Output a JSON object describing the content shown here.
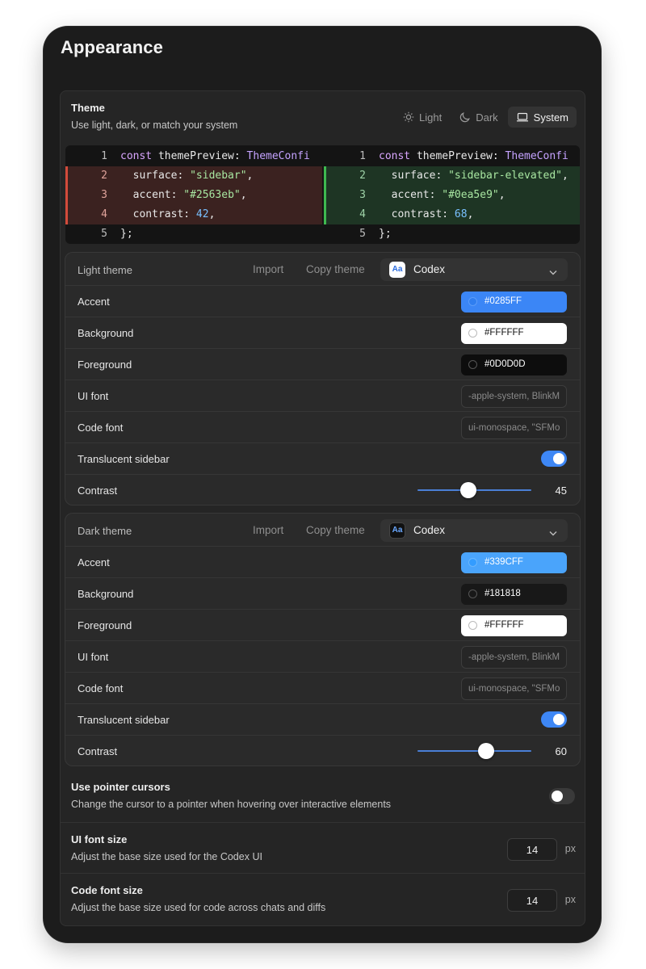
{
  "page": {
    "title": "Appearance"
  },
  "theme": {
    "title": "Theme",
    "subtitle": "Use light, dark, or match your system",
    "modes": [
      {
        "label": "Light",
        "icon": "sun-icon",
        "active": false
      },
      {
        "label": "Dark",
        "icon": "moon-icon",
        "active": false
      },
      {
        "label": "System",
        "icon": "laptop-icon",
        "active": true
      }
    ]
  },
  "diff": {
    "left": [
      {
        "n": "1",
        "parts": [
          [
            "kw",
            "const "
          ],
          [
            "prop",
            "themePreview"
          ],
          [
            "prop",
            ": "
          ],
          [
            "ty",
            "ThemeConfi"
          ]
        ],
        "changed": false
      },
      {
        "n": "2",
        "parts": [
          [
            "prop",
            "  surface: "
          ],
          [
            "str",
            "\"sidebar\""
          ],
          [
            "prop",
            ","
          ]
        ],
        "changed": true
      },
      {
        "n": "3",
        "parts": [
          [
            "prop",
            "  accent: "
          ],
          [
            "str",
            "\"#2563eb\""
          ],
          [
            "prop",
            ","
          ]
        ],
        "changed": true
      },
      {
        "n": "4",
        "parts": [
          [
            "prop",
            "  contrast: "
          ],
          [
            "num",
            "42"
          ],
          [
            "prop",
            ","
          ]
        ],
        "changed": true
      },
      {
        "n": "5",
        "parts": [
          [
            "prop",
            "};"
          ]
        ],
        "changed": false
      }
    ],
    "right": [
      {
        "n": "1",
        "parts": [
          [
            "kw",
            "const "
          ],
          [
            "prop",
            "themePreview"
          ],
          [
            "prop",
            ": "
          ],
          [
            "ty",
            "ThemeConfi"
          ]
        ],
        "changed": false
      },
      {
        "n": "2",
        "parts": [
          [
            "prop",
            "  surface: "
          ],
          [
            "str",
            "\"sidebar-elevated\""
          ],
          [
            "prop",
            ","
          ]
        ],
        "changed": true
      },
      {
        "n": "3",
        "parts": [
          [
            "prop",
            "  accent: "
          ],
          [
            "str",
            "\"#0ea5e9\""
          ],
          [
            "prop",
            ","
          ]
        ],
        "changed": true
      },
      {
        "n": "4",
        "parts": [
          [
            "prop",
            "  contrast: "
          ],
          [
            "num",
            "68"
          ],
          [
            "prop",
            ","
          ]
        ],
        "changed": true
      },
      {
        "n": "5",
        "parts": [
          [
            "prop",
            "};"
          ]
        ],
        "changed": false
      }
    ]
  },
  "light_theme": {
    "title": "Light theme",
    "import_label": "Import",
    "copy_label": "Copy theme",
    "font_badge": "Aa",
    "font_name": "Codex",
    "accent_label": "Accent",
    "accent_value": "#0285FF",
    "background_label": "Background",
    "background_value": "#FFFFFF",
    "foreground_label": "Foreground",
    "foreground_value": "#0D0D0D",
    "ui_font_label": "UI font",
    "ui_font_value": "-apple-system, BlinkM",
    "code_font_label": "Code font",
    "code_font_value": "ui-monospace, \"SFMo",
    "translucent_label": "Translucent sidebar",
    "translucent_on": true,
    "contrast_label": "Contrast",
    "contrast_value": "45",
    "contrast_fraction": 0.45
  },
  "dark_theme": {
    "title": "Dark theme",
    "import_label": "Import",
    "copy_label": "Copy theme",
    "font_badge": "Aa",
    "font_name": "Codex",
    "accent_label": "Accent",
    "accent_value": "#339CFF",
    "background_label": "Background",
    "background_value": "#181818",
    "foreground_label": "Foreground",
    "foreground_value": "#FFFFFF",
    "ui_font_label": "UI font",
    "ui_font_value": "-apple-system, BlinkM",
    "code_font_label": "Code font",
    "code_font_value": "ui-monospace, \"SFMo",
    "translucent_label": "Translucent sidebar",
    "translucent_on": true,
    "contrast_label": "Contrast",
    "contrast_value": "60",
    "contrast_fraction": 0.6
  },
  "pointer": {
    "title": "Use pointer cursors",
    "subtitle": "Change the cursor to a pointer when hovering over interactive elements",
    "on": false
  },
  "ui_font_size": {
    "title": "UI font size",
    "subtitle": "Adjust the base size used for the Codex UI",
    "value": "14",
    "unit": "px"
  },
  "code_font_size": {
    "title": "Code font size",
    "subtitle": "Adjust the base size used for code across chats and diffs",
    "value": "14",
    "unit": "px"
  }
}
